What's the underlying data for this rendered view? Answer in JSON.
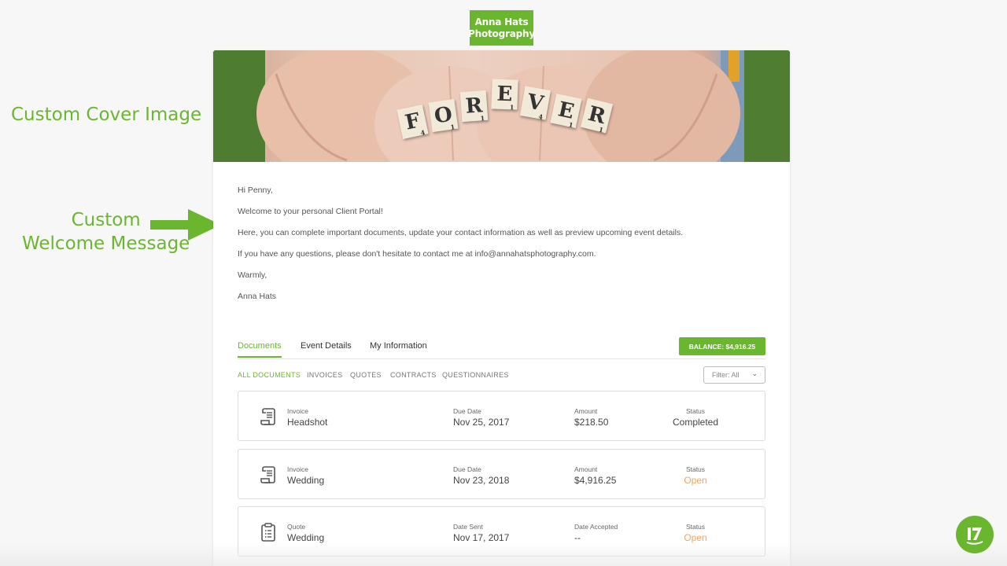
{
  "annotations": {
    "cover": "Custom Cover Image",
    "welcome_line1": "Custom",
    "welcome_line2": "Welcome Message"
  },
  "logo": {
    "text": "Anna Hats\nPhotography"
  },
  "cover_letters": [
    "F",
    "O",
    "R",
    "E",
    "V",
    "E",
    "R"
  ],
  "cover_subscripts": [
    "4",
    "1",
    "1",
    "1",
    "4",
    "1",
    "1"
  ],
  "welcome": {
    "greeting": "Hi Penny,",
    "line1": "Welcome to your personal Client Portal!",
    "line2": "Here, you can complete important documents, update your contact information as well as preview upcoming event details.",
    "line3": "If you have any questions, please don't hesitate to contact me at info@annahatsphotography.com.",
    "signoff": "Warmly,",
    "signature": "Anna Hats"
  },
  "tabs": [
    "Documents",
    "Event Details",
    "My Information"
  ],
  "balance_label": "BALANCE: $4,916.25",
  "subtabs": [
    "ALL DOCUMENTS",
    "INVOICES",
    "QUOTES",
    "CONTRACTS",
    "QUESTIONNAIRES"
  ],
  "filter_label": "Filter: All",
  "documents": [
    {
      "type": "Invoice",
      "name": "Headshot",
      "date_label": "Due Date",
      "date": "Nov 25, 2017",
      "amount_label": "Amount",
      "amount": "$218.50",
      "status_label": "Status",
      "status": "Completed",
      "icon": "invoice-scroll-icon"
    },
    {
      "type": "Invoice",
      "name": "Wedding",
      "date_label": "Due Date",
      "date": "Nov 23, 2018",
      "amount_label": "Amount",
      "amount": "$4,916.25",
      "status_label": "Status",
      "status": "Open",
      "icon": "invoice-scroll-icon"
    },
    {
      "type": "Quote",
      "name": "Wedding",
      "date_label": "Date Sent",
      "date": "Nov 17, 2017",
      "amount_label": "Date Accepted",
      "amount": "--",
      "status_label": "Status",
      "status": "Open",
      "icon": "clipboard-icon"
    }
  ],
  "colors": {
    "accent": "#6bb62f",
    "open_status": "#f3a45c"
  }
}
